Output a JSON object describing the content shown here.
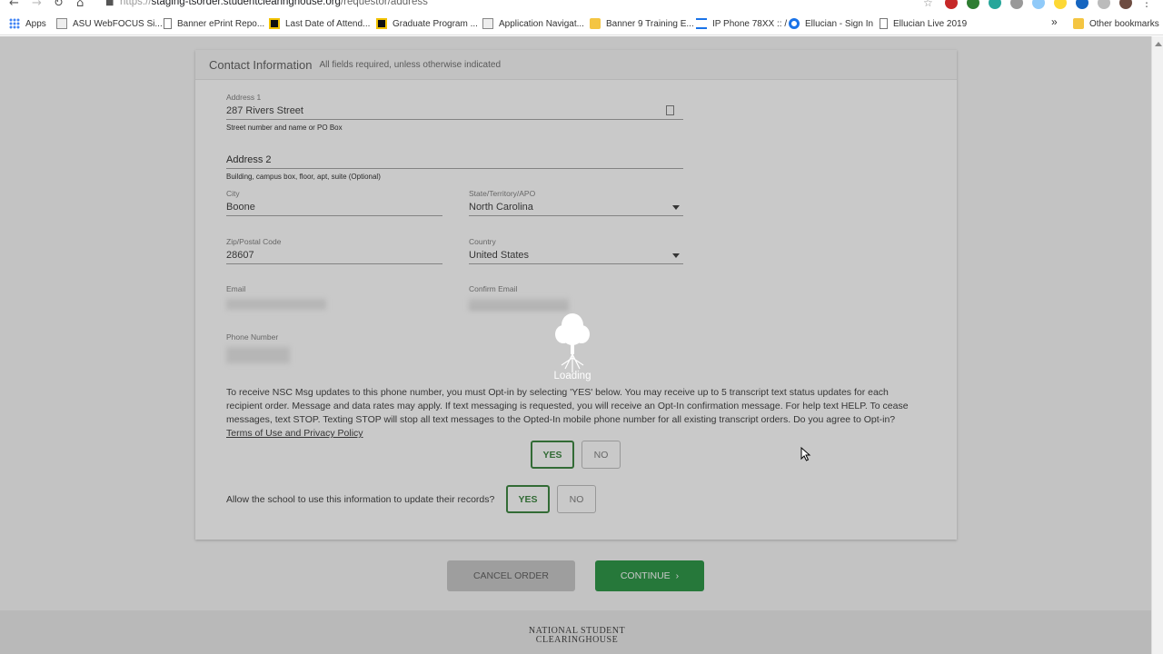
{
  "browser": {
    "url_scheme": "https://",
    "url_domain": "staging-tsorder.studentclearinghouse.org",
    "url_path": "/requestor/address",
    "bookmarks": [
      {
        "label": "Apps",
        "icon": "apps-grid-icon"
      },
      {
        "label": "ASU WebFOCUS Si...",
        "icon": "asu-icon"
      },
      {
        "label": "Banner ePrint Repo...",
        "icon": "page-icon"
      },
      {
        "label": "Last Date of Attend...",
        "icon": "appstate-icon"
      },
      {
        "label": "Graduate Program ...",
        "icon": "appstate-icon"
      },
      {
        "label": "Application Navigat...",
        "icon": "app-icon"
      },
      {
        "label": "Banner 9 Training E...",
        "icon": "folder-icon"
      },
      {
        "label": "IP Phone 78XX :: /",
        "icon": "cisco-icon"
      },
      {
        "label": "Ellucian - Sign In",
        "icon": "ellucian-icon"
      },
      {
        "label": "Ellucian Live 2019",
        "icon": "page-icon"
      }
    ],
    "overflow_label": "»",
    "other_bookmarks": "Other bookmarks"
  },
  "contact": {
    "title": "Contact Information",
    "subtitle": "All fields required, unless otherwise indicated",
    "address1_label": "Address 1",
    "address1_value": "287 Rivers Street",
    "address1_hint": "Street number and name or PO Box",
    "address2_label": "Address 2",
    "address2_hint": "Building, campus box, floor, apt, suite (Optional)",
    "city_label": "City",
    "city_value": "Boone",
    "state_label": "State/Territory/APO",
    "state_value": "North Carolina",
    "zip_label": "Zip/Postal Code",
    "zip_value": "28607",
    "country_label": "Country",
    "country_value": "United States",
    "email_label": "Email",
    "confirm_email_label": "Confirm Email",
    "phone_label": "Phone Number",
    "optin_text": "To receive NSC Msg updates to this phone number, you must Opt-in by selecting 'YES' below. You may receive up to 5 transcript text status updates for each recipient order. Message and data rates may apply. If text messaging is requested, you will receive an Opt-In confirmation message. For help text HELP. To cease messages, text STOP. Texting STOP will stop all text messages to the Opted-In mobile phone number for all existing transcript orders. Do you agree to Opt-in?",
    "terms_link": "Terms of Use and Privacy Policy",
    "optin_yes": "YES",
    "optin_no": "NO",
    "school_question": "Allow the school to use this information to update their records?",
    "school_yes": "YES",
    "school_no": "NO"
  },
  "actions": {
    "cancel": "CANCEL ORDER",
    "continue": "CONTINUE",
    "continue_icon": "›"
  },
  "footer": {
    "logo_line1": "NATIONAL STUDENT",
    "logo_line2": "CLEARINGHOUSE"
  },
  "loading": {
    "text": "Loading",
    "icon": "tree-icon"
  }
}
